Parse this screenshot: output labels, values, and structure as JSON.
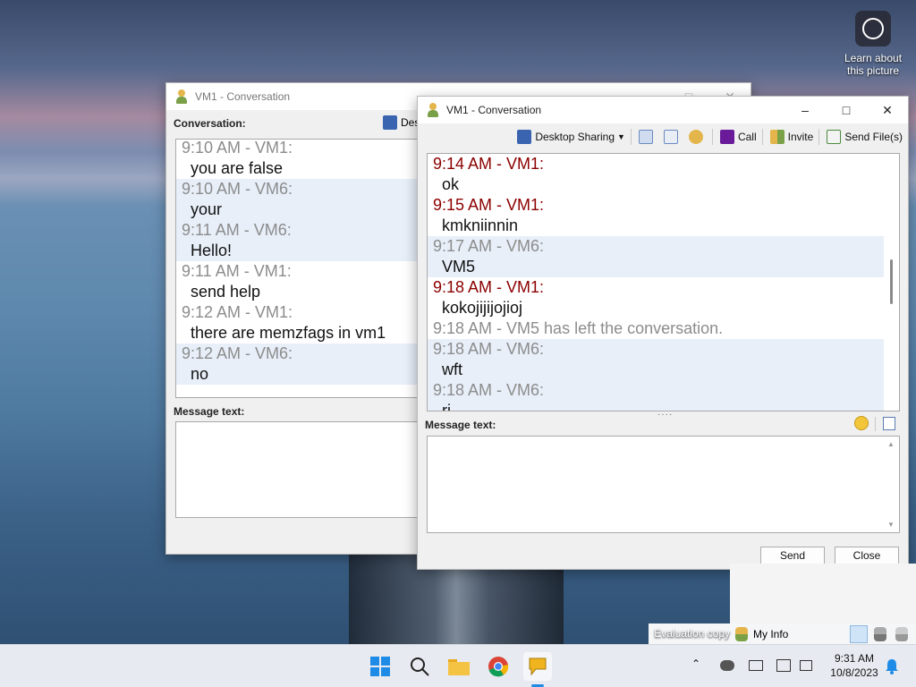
{
  "desktop": {
    "learn_label": "Learn about this picture",
    "evaluation_label": "Evaluation copy"
  },
  "back_window": {
    "title": "VM1 - Conversation",
    "toolbar_partial": "Des",
    "conversation_label": "Conversation:",
    "message_label": "Message text:",
    "messages": [
      {
        "head": "9:10 AM - VM1:",
        "body": "you are false",
        "me": false,
        "hl": false
      },
      {
        "head": "9:10 AM - VM6:",
        "body": "your",
        "me": false,
        "hl": true
      },
      {
        "head": "9:11 AM - VM6:",
        "body": "Hello!",
        "me": false,
        "hl": true
      },
      {
        "head": "9:11 AM - VM1:",
        "body": "send help",
        "me": false,
        "hl": false
      },
      {
        "head": "9:12 AM - VM1:",
        "body": "there are memzfags in vm1",
        "me": false,
        "hl": false
      },
      {
        "head": "9:12 AM - VM6:",
        "body": "no",
        "me": false,
        "hl": true
      }
    ]
  },
  "front_window": {
    "title": "VM1 - Conversation",
    "toolbar": {
      "desktop_sharing": "Desktop Sharing",
      "call": "Call",
      "invite": "Invite",
      "send_files": "Send File(s)"
    },
    "messages": [
      {
        "type": "msg",
        "head": "9:14 AM - VM1:",
        "body": "ok",
        "me": true,
        "hl": false
      },
      {
        "type": "msg",
        "head": "9:15 AM - VM1:",
        "body": "kmkniinnin",
        "me": true,
        "hl": false
      },
      {
        "type": "msg",
        "head": "9:17 AM - VM6:",
        "body": "VM5",
        "me": false,
        "hl": true
      },
      {
        "type": "msg",
        "head": "9:18 AM - VM1:",
        "body": "kokojijijojioj",
        "me": true,
        "hl": false
      },
      {
        "type": "sys",
        "text": "9:18 AM - VM5 has left the conversation."
      },
      {
        "type": "msg",
        "head": "9:18 AM - VM6:",
        "body": "wft",
        "me": false,
        "hl": true
      },
      {
        "type": "msg",
        "head": "9:18 AM - VM6:",
        "body": "ri",
        "me": false,
        "hl": true
      }
    ],
    "message_label": "Message text:",
    "send_label": "Send",
    "close_label": "Close"
  },
  "status_strip": {
    "my_info": "My Info"
  },
  "tray": {
    "time": "9:31 AM",
    "date": "10/8/2023"
  },
  "colors": {
    "my_name": "#8b0000",
    "other_name": "#8c8c8c",
    "highlight_row": "#e8eff9"
  }
}
